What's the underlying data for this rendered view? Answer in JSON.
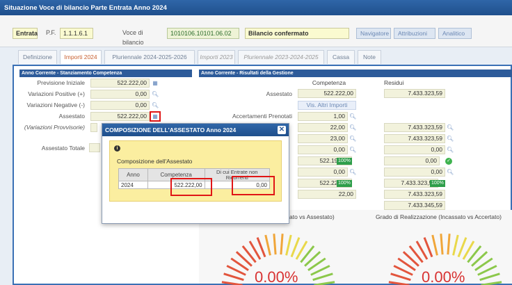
{
  "window": {
    "title": "Situazione Voce di bilancio Parte Entrata Anno 2024"
  },
  "header": {
    "type_value": "Entrata",
    "pf_label": "P.F.",
    "pf_value": "1.1.1.6.1",
    "voce_label": "Voce di bilancio",
    "voce_value": "1010106.10101.06.02",
    "status_value": "Bilancio confermato",
    "buttons": {
      "navigatore": "Navigatore",
      "attribuzioni": "Attribuzioni",
      "analitico": "Analitico"
    }
  },
  "tabs": [
    {
      "label": "Definizione"
    },
    {
      "label": "Importi 2024"
    },
    {
      "label": "Pluriennale 2024-2025-2026"
    },
    {
      "label": "Importi 2023"
    },
    {
      "label": "Pluriennale 2023-2024-2025"
    },
    {
      "label": "Cassa"
    },
    {
      "label": "Note"
    }
  ],
  "left_panel": {
    "header": "Anno Corrente - Stanziamento Competenza",
    "previsione_label": "Previsione Iniziale",
    "previsione_value": "522.222,00",
    "var_pos_label": "Variazioni Positive (+)",
    "var_pos_value": "0,00",
    "var_neg_label": "Variazioni Negative (-)",
    "var_neg_value": "0,00",
    "assestato_label": "Assestato",
    "assestato_value": "522.222,00",
    "var_prov_label": "(Variazioni Provvisorie)",
    "assestato_tot_label": "Assestato Totale"
  },
  "right_panel": {
    "header": "Anno Corrente - Risultati della Gestione",
    "col_competenza": "Competenza",
    "col_residui": "Residui",
    "assestato_label": "Assestato",
    "assestato_comp": "522.222,00",
    "assestato_res": "7.433.323,59",
    "vis_altri": "Vis. Altri Importi",
    "acc_prenotati_label": "Accertamenti Prenotati",
    "acc_prenotati_comp": "1,00",
    "rows": [
      {
        "comp": "22,00",
        "res": "7.433.323,59"
      },
      {
        "comp": "23,00",
        "res": "7.433.323,59"
      },
      {
        "comp": "0,00",
        "res": "0,00"
      },
      {
        "comp": "522.199,00",
        "comp_badge": "100%",
        "res": "0,00"
      },
      {
        "comp": "0,00",
        "res": "0,00"
      },
      {
        "comp": "522.222,00",
        "comp_badge": "100%",
        "res": "7.433.323,59",
        "res_badge": "100%"
      },
      {
        "comp": "22,00",
        "res": "7.433.323,59"
      },
      {
        "res": "7.433.345,59"
      }
    ]
  },
  "gauges": {
    "left_title": "ato vs Assestato)",
    "right_title": "Grado di Realizzazione (Incassato vs Accertato)",
    "left_pct": "0.00%",
    "right_pct": "0.00%",
    "left_value": 0,
    "right_value": 0
  },
  "modal": {
    "title": "COMPOSIZIONE DELL'ASSESTATO Anno 2024",
    "heading": "Composizione dell'Assestato",
    "table": {
      "headers": [
        "Anno",
        "Competenza",
        "Di cui Entrate non Ricorrenti"
      ],
      "rows": [
        [
          "2024",
          "522.222,00",
          "0,00"
        ]
      ]
    }
  },
  "colors": {
    "accent": "#2d5b9a",
    "highlight": "#e01515",
    "badge": "#2e9e4a"
  }
}
